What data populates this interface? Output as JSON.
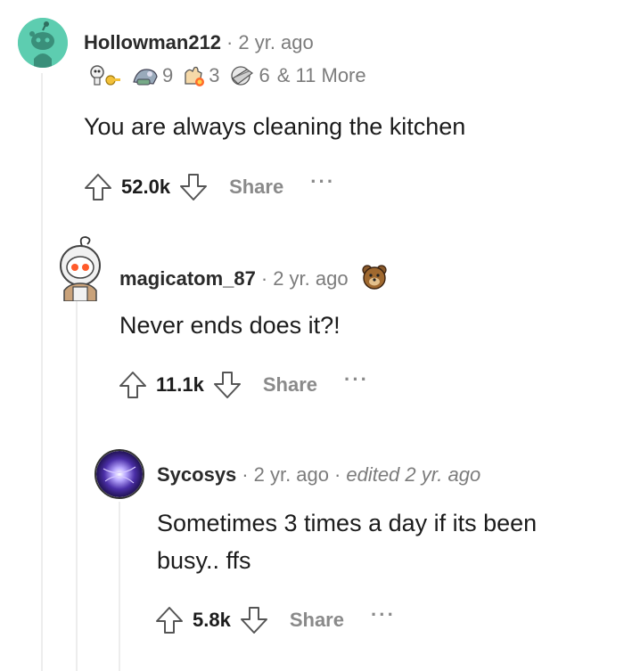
{
  "comments": [
    {
      "username": "Hollowman212",
      "time": "2 yr. ago",
      "awards": [
        {
          "icon": "skeleton-key-icon",
          "count": ""
        },
        {
          "icon": "wholesome-seal-icon",
          "count": "9"
        },
        {
          "icon": "helpful-hand-icon",
          "count": "3"
        },
        {
          "icon": "facepalm-icon",
          "count": "6"
        }
      ],
      "awards_more": "& 11 More",
      "text": "You are always cleaning the kitchen",
      "score": "52.0k",
      "share_label": "Share",
      "more_label": "···"
    },
    {
      "username": "magicatom_87",
      "time": "2 yr. ago",
      "flair_icon": "bear-emoji-icon",
      "text": "Never ends does it?!",
      "score": "11.1k",
      "share_label": "Share",
      "more_label": "···"
    },
    {
      "username": "Sycosys",
      "time": "2 yr. ago",
      "edited": "edited 2 yr. ago",
      "text_line1": "Sometimes 3 times a day if its been",
      "text_line2": "busy.. ffs",
      "score": "5.8k",
      "share_label": "Share",
      "more_label": "···"
    }
  ],
  "colors": {
    "avatar1_bg": "#5dcdb0",
    "thread_line": "#ededed",
    "meta_gray": "#7c7c7c",
    "text": "#1c1c1c"
  }
}
